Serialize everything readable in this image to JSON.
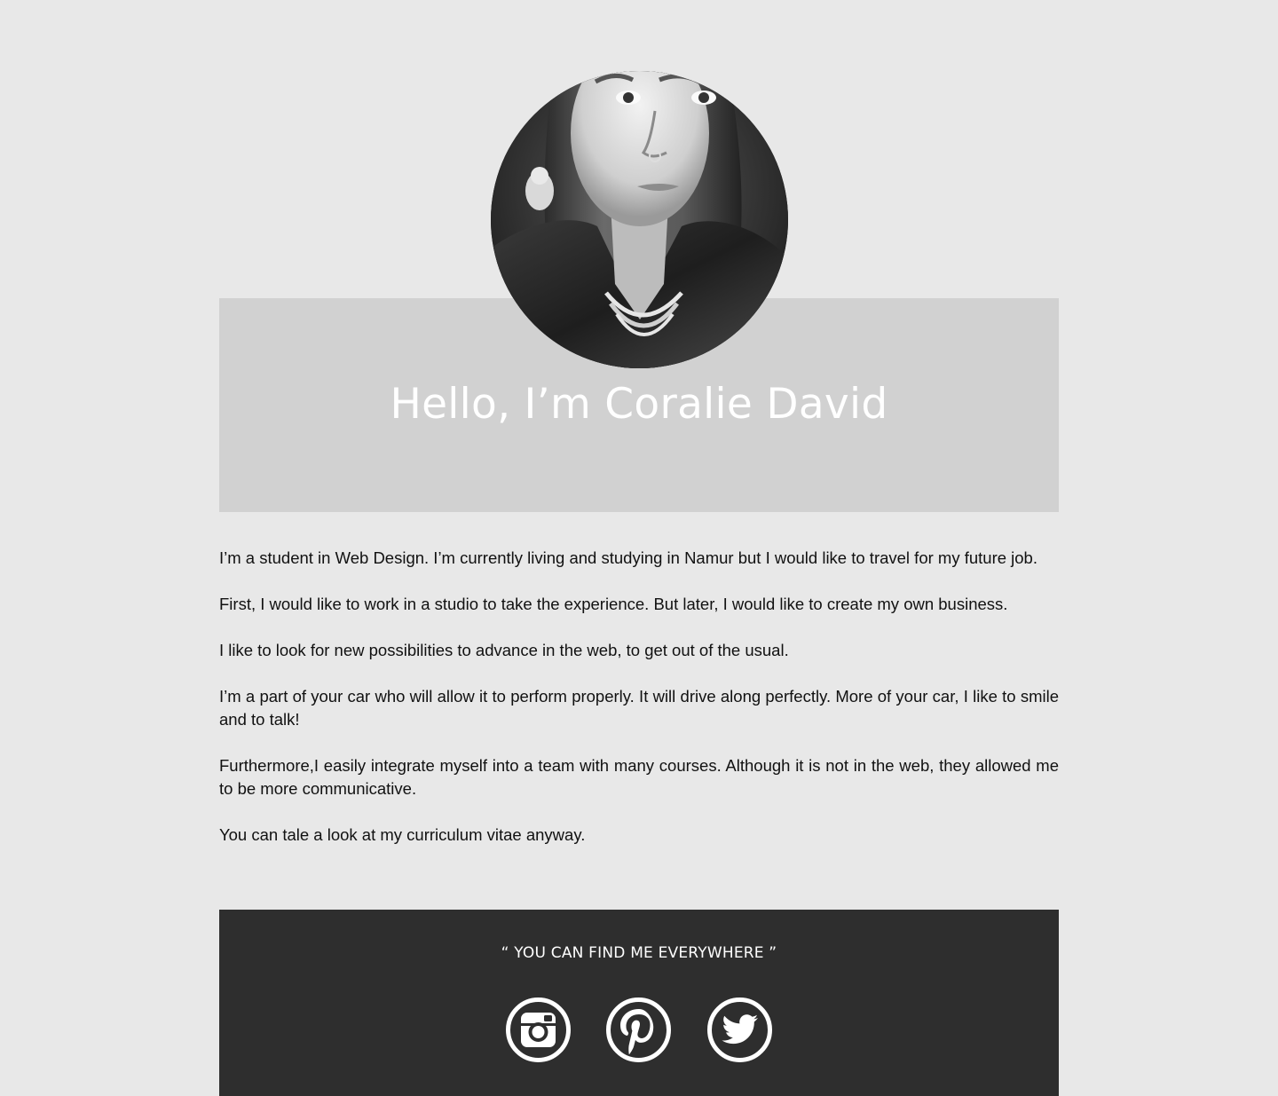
{
  "profile": {
    "photo_alt": "Portrait of Coralie David"
  },
  "hero": {
    "title": "Hello, I’m Coralie David"
  },
  "bio": {
    "paragraphs": [
      "I’m a student in Web Design. I’m currently living and studying in Namur but I would like to travel for my future job.",
      "First, I would like to work in a studio to take the experience. But later, I would like to create my own business.",
      "I like to look for new possibilities to advance in the web, to get out of the usual.",
      "I’m a part of your car who will allow it to perform properly. It will drive along perfectly. More of your car, I like to smile and to talk!",
      "Furthermore,I easily integrate myself into a team with many courses. Although it is not in the web, they allowed me to be more communicative.",
      "You can tale a look at my curriculum vitae anyway."
    ]
  },
  "footer": {
    "quote": "“ YOU CAN FIND ME EVERYWHERE ”",
    "social": [
      {
        "icon": "instagram-icon"
      },
      {
        "icon": "pinterest-icon"
      },
      {
        "icon": "twitter-icon"
      }
    ]
  },
  "colors": {
    "page_background": "#e8e8e8",
    "hero_background": "#d1d1d1",
    "footer_background": "#2e2e2e",
    "text": "#111111",
    "heading_text": "#ffffff"
  }
}
